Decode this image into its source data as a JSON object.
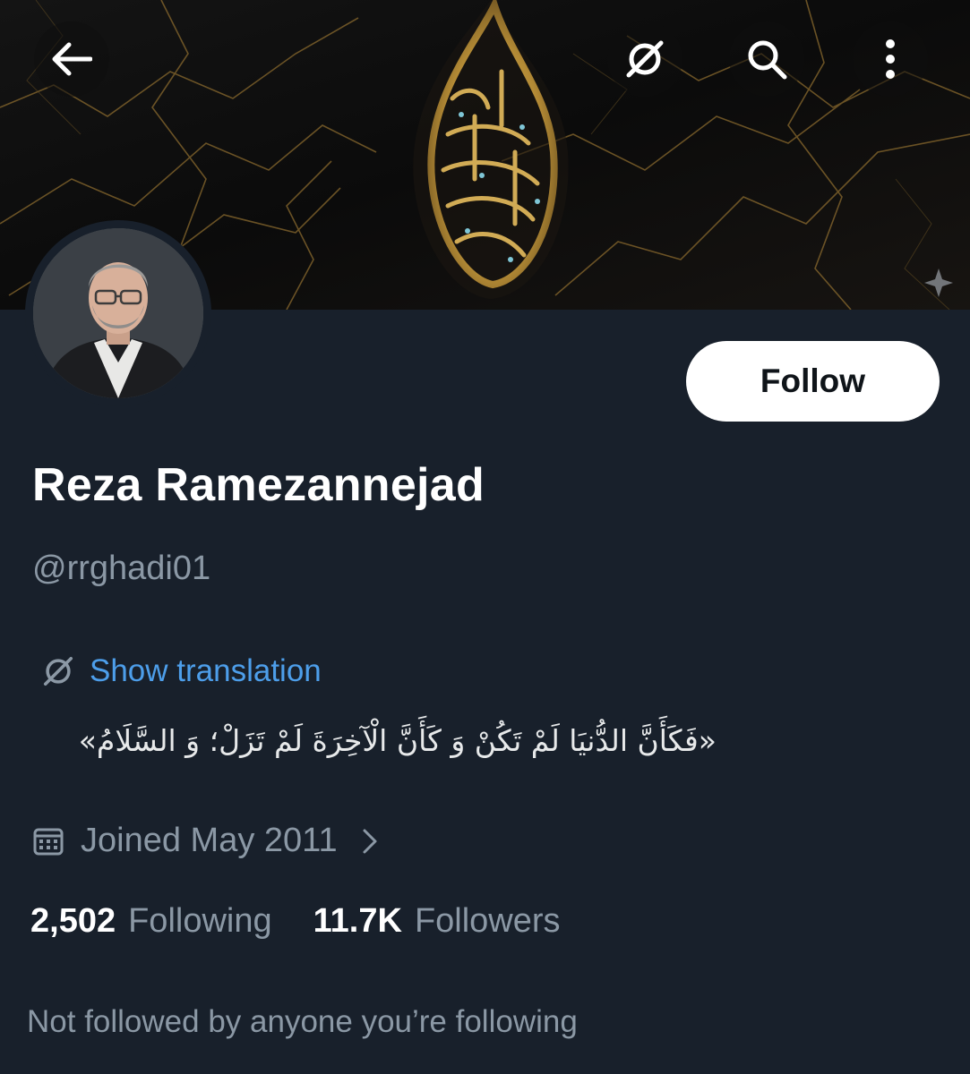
{
  "header": {
    "back_icon": "arrow-left-icon",
    "translate_icon": "translate-icon",
    "search_icon": "search-icon",
    "more_icon": "more-vertical-icon"
  },
  "profile": {
    "display_name": "Reza Ramezannejad",
    "handle": "@rrghadi01",
    "follow_label": "Follow",
    "show_translation_label": "Show translation",
    "bio": "«فَکَأَنَّ الدُّنیَا لَمْ تَکُنْ وَ کَأَنَّ الْآخِرَةَ لَمْ تَزَلْ؛ وَ السَّلَامُ»",
    "joined": "Joined May 2011",
    "following_count": "2,502",
    "following_label": "Following",
    "followers_count": "11.7K",
    "followers_label": "Followers",
    "mutuals_text": "Not followed by anyone you’re following"
  },
  "colors": {
    "background": "#18202b",
    "link": "#4d9eea",
    "secondary_text": "#8b98a5",
    "primary_text": "#ffffff",
    "banner_gold": "#c9a24a"
  }
}
